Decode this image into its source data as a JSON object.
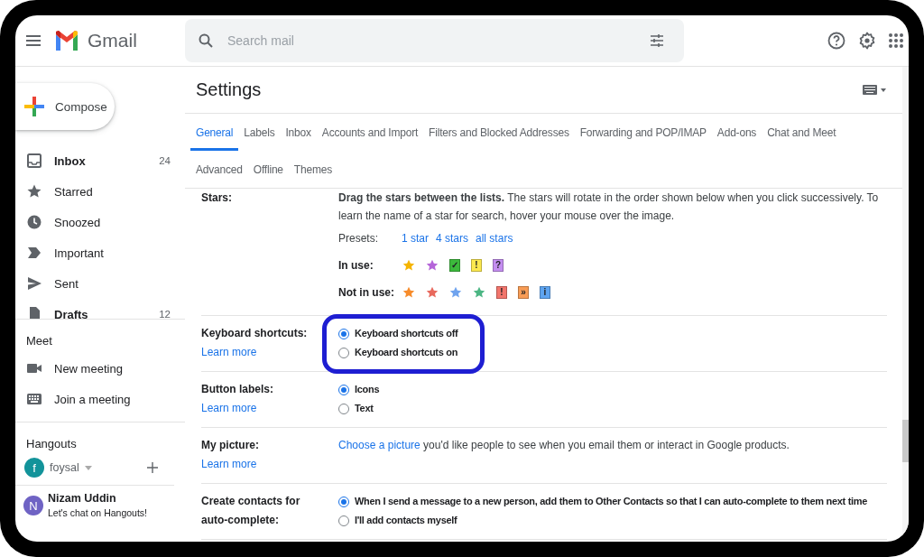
{
  "app": {
    "name": "Gmail"
  },
  "search": {
    "placeholder": "Search mail"
  },
  "compose": {
    "label": "Compose"
  },
  "nav": [
    {
      "label": "Inbox",
      "count": "24",
      "unread": true
    },
    {
      "label": "Starred",
      "unread": false
    },
    {
      "label": "Snoozed",
      "unread": false
    },
    {
      "label": "Important",
      "unread": false
    },
    {
      "label": "Sent",
      "unread": false
    },
    {
      "label": "Drafts",
      "count": "12",
      "unread": true
    }
  ],
  "meet": {
    "title": "Meet",
    "items": [
      {
        "label": "New meeting"
      },
      {
        "label": "Join a meeting"
      }
    ]
  },
  "hangouts": {
    "title": "Hangouts",
    "user": {
      "initial": "f",
      "name": "foysal",
      "color": "#12939a"
    },
    "contacts": [
      {
        "initial": "N",
        "name": "Nizam Uddin",
        "message": "Let's chat on Hangouts!",
        "color": "#6f63c4"
      }
    ]
  },
  "page_title": "Settings",
  "tab_rows": [
    [
      {
        "label": "General",
        "selected": true
      },
      {
        "label": "Labels",
        "selected": false
      },
      {
        "label": "Inbox",
        "selected": false
      },
      {
        "label": "Accounts and Import",
        "selected": false
      },
      {
        "label": "Filters and Blocked Addresses",
        "selected": false
      },
      {
        "label": "Forwarding and POP/IMAP",
        "selected": false
      },
      {
        "label": "Add-ons",
        "selected": false
      },
      {
        "label": "Chat and Meet",
        "selected": false
      }
    ],
    [
      {
        "label": "Advanced",
        "selected": false
      },
      {
        "label": "Offline",
        "selected": false
      },
      {
        "label": "Themes",
        "selected": false
      }
    ]
  ],
  "settings": [
    {
      "kind": "stars",
      "label": "Stars:",
      "description": "**Drag the stars between the lists.**  The stars will rotate in the order shown below when you click successively. To learn the name of a star for search, hover your mouse over the image.",
      "presets_label": "Presets:",
      "presets": [
        "1 star",
        "4 stars",
        "all stars"
      ],
      "groups": [
        {
          "label": "In use:",
          "items": [
            {
              "kind": "star",
              "color": "#f5b400"
            },
            {
              "kind": "star",
              "color": "#b565d9"
            },
            {
              "kind": "box",
              "glyph": "✓",
              "color": "#3cba3c"
            },
            {
              "kind": "box",
              "glyph": "!",
              "color": "#fce94f"
            },
            {
              "kind": "box",
              "glyph": "?",
              "color": "#c48ef0"
            }
          ]
        },
        {
          "label": "Not in use:",
          "items": [
            {
              "kind": "star",
              "color": "#f78c2b"
            },
            {
              "kind": "star",
              "color": "#e8695d"
            },
            {
              "kind": "star",
              "color": "#6fa3ee"
            },
            {
              "kind": "star",
              "color": "#4cb684"
            },
            {
              "kind": "box",
              "glyph": "!",
              "color": "#f2756c"
            },
            {
              "kind": "box",
              "glyph": "»",
              "color": "#f89c55"
            },
            {
              "kind": "box",
              "glyph": "i",
              "color": "#5ea4f0"
            }
          ]
        }
      ]
    },
    {
      "kind": "radio",
      "label": "Keyboard shortcuts:",
      "link": "Learn more",
      "highlighted": true,
      "options": [
        {
          "label": "Keyboard shortcuts off",
          "selected": true
        },
        {
          "label": "Keyboard shortcuts on",
          "selected": false
        }
      ]
    },
    {
      "kind": "radio",
      "label": "Button labels:",
      "link": "Learn more",
      "highlighted": false,
      "options": [
        {
          "label": "Icons",
          "selected": true
        },
        {
          "label": "Text",
          "selected": false
        }
      ]
    },
    {
      "kind": "text",
      "label": "My picture:",
      "link": "Learn more",
      "text_link": "Choose a picture",
      "text": " you'd like people to see when you email them or interact in Google products."
    },
    {
      "kind": "radio",
      "label": "Create contacts for auto-complete:",
      "highlighted": false,
      "options": [
        {
          "label": "When I send a message to a new person, add them to Other Contacts so that I can auto-complete to them next time",
          "selected": true
        },
        {
          "label": "I'll add contacts myself",
          "selected": false
        }
      ]
    }
  ]
}
